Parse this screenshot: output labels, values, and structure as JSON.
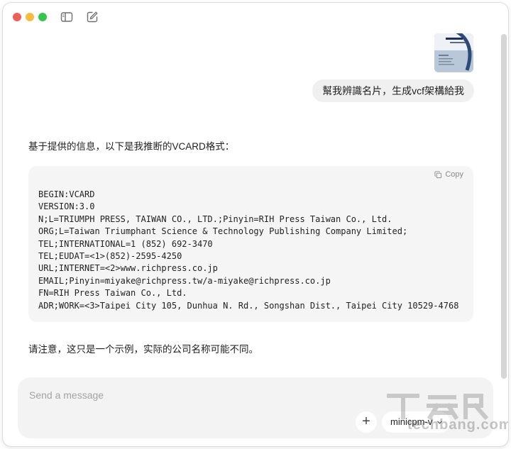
{
  "chat": {
    "user_message": "幫我辨識名片，生成vcf架構給我",
    "assistant_intro": "基于提供的信息，以下是我推断的VCARD格式：",
    "copy_label": "Copy",
    "code_lines": [
      "BEGIN:VCARD",
      "VERSION:3.0",
      "N;L=TRIUMPH PRESS, TAIWAN CO., LTD.;Pinyin=RIH Press Taiwan Co., Ltd.",
      "ORG;L=Taiwan Triumphant Science & Technology Publishing Company Limited;",
      "TEL;INTERNATIONAL=1 (852) 692-3470",
      "TEL;EUDAT=<1>(852)-2595-4250",
      "URL;INTERNET=<2>www.richpress.co.jp",
      "EMAIL;Pinyin=miyake@richpress.tw/a-miyake@richpress.co.jp",
      "FN=RIH Press Taiwan Co., Ltd.",
      "ADR;WORK=<3>Taipei City 105, Dunhua N. Rd., Songshan Dist., Taipei City 10529-4768"
    ],
    "assistant_note": "请注意，这只是一个示例，实际的公司名称可能不同。"
  },
  "composer": {
    "placeholder": "Send a message",
    "model": "minicpm-v"
  },
  "watermark": {
    "url": "techbang.com"
  },
  "colors": {
    "traffic_red": "#ee5f57",
    "traffic_yellow": "#f6bd3a",
    "traffic_green": "#33c748",
    "bubble": "#f0f0f0",
    "code_bg": "#f5f5f5"
  }
}
